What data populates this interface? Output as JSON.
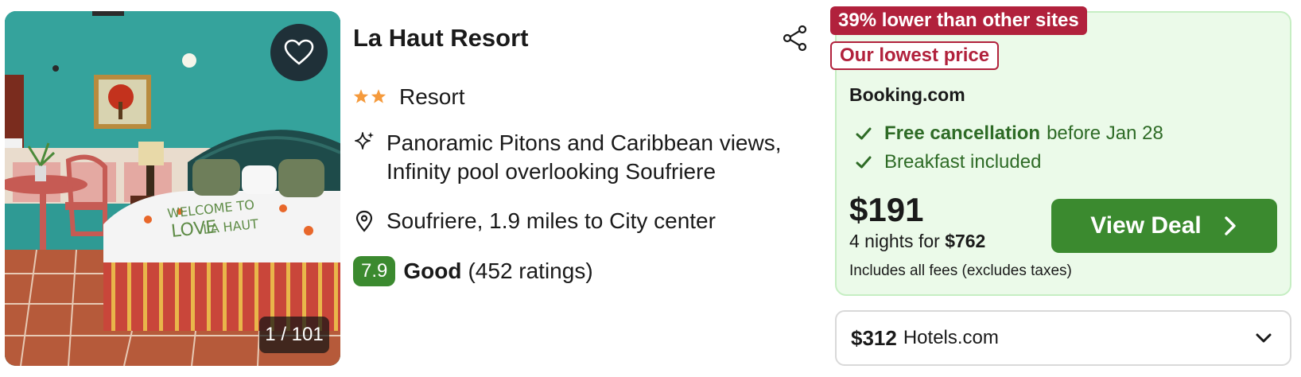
{
  "listing": {
    "name": "La Haut Resort",
    "star_count": 2,
    "property_type": "Resort",
    "highlights": [
      "Panoramic Pitons and Caribbean views,",
      "Infinity pool overlooking Soufriere"
    ],
    "location": "Soufriere, 1.9 miles to City center",
    "rating": {
      "score": "7.9",
      "word": "Good",
      "count": "(452 ratings)"
    }
  },
  "photo": {
    "counter": "1 / 101",
    "bed_text": "WELCOME TO LA HAUT LOVE"
  },
  "deal": {
    "tag_primary": "39% lower than other sites",
    "tag_secondary": "Our lowest price",
    "provider": "Booking.com",
    "perk1_bold": "Free cancellation",
    "perk1_rest": "before Jan 28",
    "perk2": "Breakfast included",
    "price": "$191",
    "nights_prefix": "4 nights for ",
    "nights_total": "$762",
    "fees_note": "Includes all fees (excludes taxes)",
    "cta_label": "View Deal"
  },
  "alt_offer": {
    "price": "$312",
    "site": "Hotels.com"
  },
  "colors": {
    "accent_green": "#3b8a2f",
    "deal_tag_red": "#b1213c",
    "star_orange": "#f59a3c",
    "card_bg": "#ebfae9"
  },
  "icons": [
    "heart-icon",
    "share-icon",
    "star-icon",
    "sparkle-icon",
    "map-pin-icon",
    "check-icon",
    "chevron-right-icon",
    "chevron-down-icon"
  ]
}
